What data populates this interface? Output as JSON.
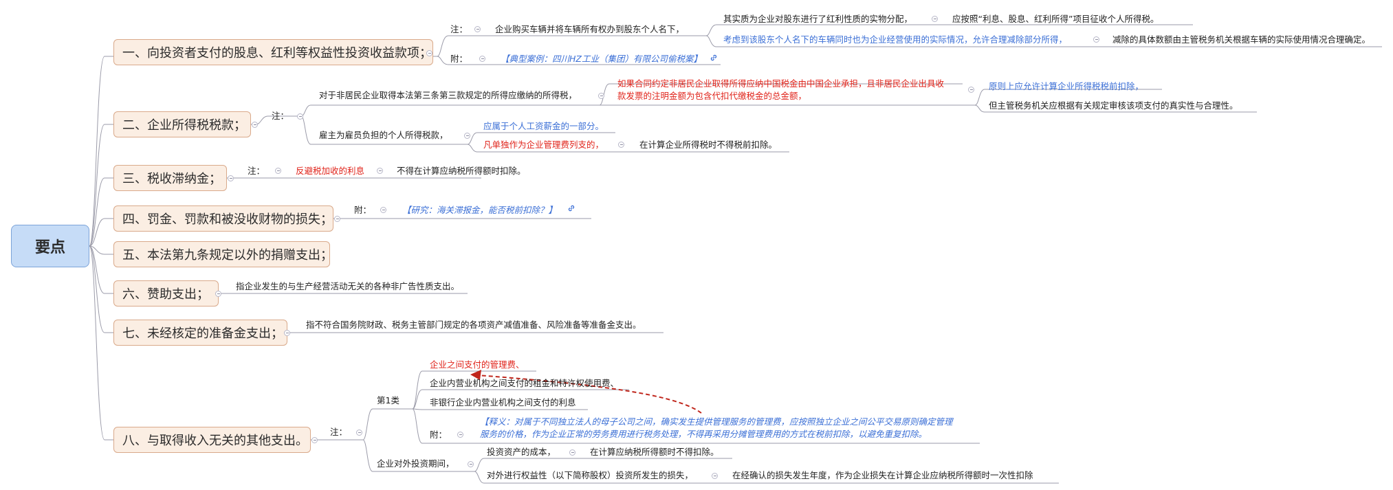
{
  "root": "要点",
  "branches": [
    "一、向投资者支付的股息、红利等权益性投资收益款项；",
    "二、企业所得税税款；",
    "三、税收滞纳金；",
    "四、罚金、罚款和被没收财物的损失；",
    "五、本法第九条规定以外的捐赠支出；",
    "六、赞助支出；",
    "七、未经核定的准备金支出；",
    "八、与取得收入无关的其他支出。"
  ],
  "b1": {
    "zhu": "注：",
    "fu": "附：",
    "n1": "企业购买车辆并将车辆所有权办到股东个人名下，",
    "n2": "其实质为企业对股东进行了红利性质的实物分配，",
    "n3": "应按照“利息、股息、红利所得”项目征收个人所得税。",
    "n4": "考虑到该股东个人名下的车辆同时也为企业经营使用的实际情况，允许合理减除部分所得，",
    "n5": "减除的具体数额由主管税务机关根据车辆的实际使用情况合理确定。",
    "case": "【典型案例：四川HZ工业（集团）有限公司偷税案】"
  },
  "b2": {
    "zhu": "注：",
    "n1": "对于非居民企业取得本法第三条第三款规定的所得应缴纳的所得税，",
    "n2a": "如果合同约定非居民企业取得所得应纳中国税金由中国企业承担，且非居民企业出具收",
    "n2b": "款发票的注明金额为包含代扣代缴税金的总金额，",
    "n3": "原则上应允许计算企业所得税税前扣除，",
    "n4": "但主管税务机关应根据有关规定审核该项支付的真实性与合理性。",
    "n5": "雇主为雇员负担的个人所得税款，",
    "n6": "应属于个人工资薪金的一部分。",
    "n7": "凡单独作为企业管理费列支的，",
    "n8": "在计算企业所得税时不得税前扣除。"
  },
  "b3": {
    "zhu": "注：",
    "n1": "反避税加收的利息",
    "n2": "不得在计算应纳税所得额时扣除。"
  },
  "b4": {
    "fu": "附：",
    "n1": "【研究：海关滞报金，能否税前扣除？】"
  },
  "b6": {
    "n1": "指企业发生的与生产经营活动无关的各种非广告性质支出。"
  },
  "b7": {
    "n1": "指不符合国务院财政、税务主管部门规定的各项资产减值准备、风险准备等准备金支出。"
  },
  "b8": {
    "zhu": "注：",
    "cat1": "第1类",
    "i1": "企业之间支付的管理费、",
    "i2": "企业内营业机构之间支付的租金和特许权使用费、",
    "i3": "非银行企业内营业机构之间支付的利息",
    "fu": "附：",
    "note_a": "【释义：对属于不同独立法人的母子公司之间，确实发生提供管理服务的管理费，应按照独立企业之间公平交易原则确定管理",
    "note_b": "服务的价格，作为企业正常的劳务费用进行税务处理，不得再采用分摊管理费用的方式在税前扣除，以避免重复扣除。",
    "inv": "企业对外投资期间，",
    "inv1": "投资资产的成本，",
    "inv2": "在计算应纳税所得额时不得扣除。",
    "inv3": "对外进行权益性（以下简称股权）投资所发生的损失，",
    "inv4": "在经确认的损失发生年度，作为企业损失在计算企业应纳税所得额时一次性扣除"
  },
  "colors": {
    "line": "#9a9aa8",
    "branch_fill": "#fbeee3",
    "root_fill": "#c6dcf7",
    "red": "#e0241b",
    "blue": "#3b6fd6",
    "arrow": "#c0261c"
  }
}
